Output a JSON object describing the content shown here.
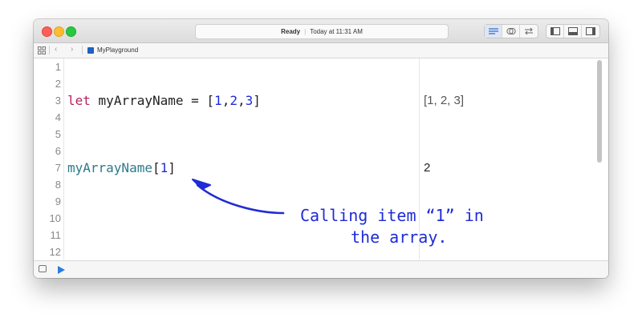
{
  "window": {
    "status_state": "Ready",
    "status_time": "Today at 11:31 AM",
    "file_name": "MyPlayground"
  },
  "editor": {
    "line_numbers": [
      "1",
      "2",
      "3",
      "4",
      "5",
      "6",
      "7",
      "8",
      "9",
      "10",
      "11",
      "12"
    ],
    "line3": {
      "keyword": "let",
      "name": "myArrayName",
      "assign": " = [",
      "v1": "1",
      "c1": ",",
      "v2": "2",
      "c2": ",",
      "v3": "3",
      "close": "]"
    },
    "line7": {
      "name": "myArrayName",
      "open": "[",
      "index": "1",
      "close": "]"
    }
  },
  "results": {
    "line3": "[1, 2, 3]",
    "line7": "2"
  },
  "annotation": {
    "line1": "Calling item “1” in",
    "line2": "the array."
  },
  "colors": {
    "keyword": "#b5245f",
    "number": "#1f2bd6",
    "identifier_teal": "#2c7a8a",
    "annotation": "#1f2bd6"
  }
}
